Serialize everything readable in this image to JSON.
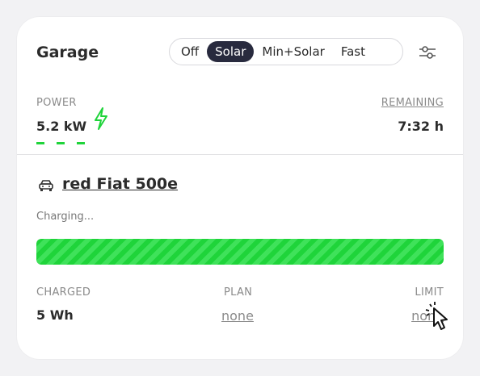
{
  "header": {
    "title": "Garage",
    "modes": [
      "Off",
      "Solar",
      "Min+Solar",
      "Fast"
    ],
    "active_mode": "Solar"
  },
  "power": {
    "label": "POWER",
    "value": "5.2 kW"
  },
  "remaining": {
    "label": "REMAINING",
    "value": "7:32 h"
  },
  "vehicle": {
    "name": "red Fiat 500e",
    "status": "Charging..."
  },
  "progress": {
    "fill_fraction": 1.0
  },
  "stats": {
    "charged_label": "CHARGED",
    "charged_value": "5 Wh",
    "plan_label": "PLAN",
    "plan_value": "none",
    "limit_label": "LIMIT",
    "limit_value": "none"
  },
  "colors": {
    "accent_green": "#1fd43a",
    "active_mode_bg": "#282a3e",
    "card_bg": "#ffffff",
    "page_bg": "#f2f2f4"
  },
  "icons": [
    "settings-sliders-icon",
    "lightning-bolt-icon",
    "car-icon",
    "pointer-cursor-icon"
  ]
}
